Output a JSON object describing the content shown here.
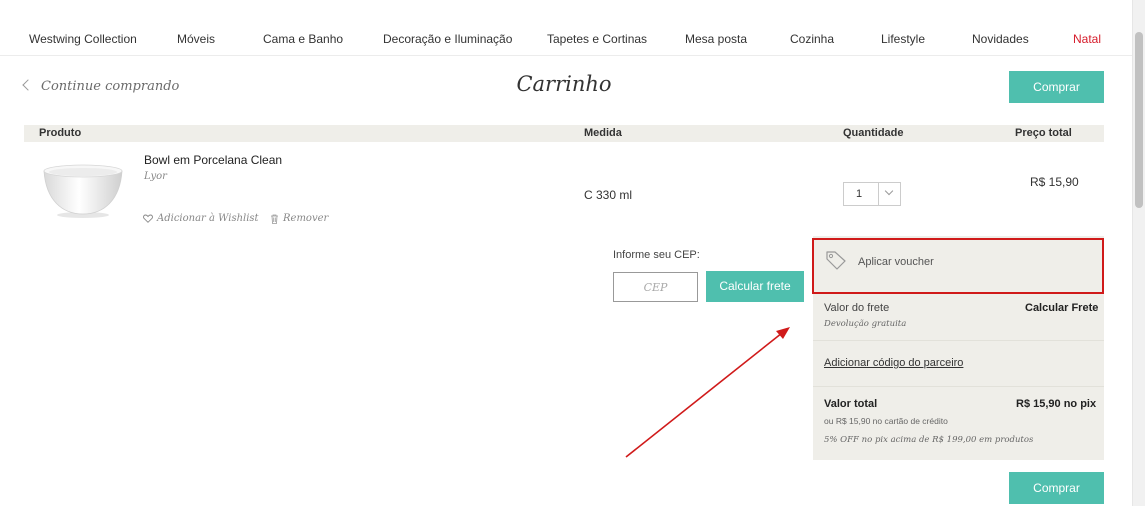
{
  "nav": {
    "items": [
      {
        "label": "Westwing Collection"
      },
      {
        "label": "Móveis"
      },
      {
        "label": "Cama e Banho"
      },
      {
        "label": "Decoração e Iluminação"
      },
      {
        "label": "Tapetes e Cortinas"
      },
      {
        "label": "Mesa posta"
      },
      {
        "label": "Cozinha"
      },
      {
        "label": "Lifestyle"
      },
      {
        "label": "Novidades"
      },
      {
        "label": "Natal",
        "highlight": true
      }
    ]
  },
  "header": {
    "continue_label": "Continue comprando",
    "title": "Carrinho",
    "buy_label": "Comprar"
  },
  "table": {
    "columns": [
      "Produto",
      "Medida",
      "Quantidade",
      "Preço total"
    ]
  },
  "cart_item": {
    "name": "Bowl em Porcelana Clean",
    "brand": "Lyor",
    "size": "C 330 ml",
    "quantity": "1",
    "price": "R$ 15,90",
    "wishlist_label": "Adicionar à Wishlist",
    "remove_label": "Remover"
  },
  "shipping": {
    "cep_label": "Informe seu CEP:",
    "cep_placeholder": "CEP",
    "calc_button": "Calcular frete"
  },
  "summary": {
    "voucher_label": "Aplicar voucher",
    "freight_label": "Valor do frete",
    "freight_value": "Calcular Frete",
    "returns_note": "Devolução gratuita",
    "partner_link": "Adicionar código do parceiro",
    "total_label": "Valor total",
    "total_value": "R$ 15,90 no pix",
    "credit_note": "ou R$ 15,90 no cartão de crédito",
    "pix_note": "5% OFF no pix acima de R$ 199,00 em produtos"
  },
  "footer": {
    "buy_label": "Comprar"
  },
  "colors": {
    "accent": "#4fbfae",
    "highlight_red": "#d61c2b",
    "annotation_red": "#d01a1a",
    "panel_bg": "#efeee9"
  },
  "icons": {
    "continue": "chevron-left-icon",
    "wishlist": "heart-icon",
    "remove": "trash-icon",
    "voucher": "tag-icon",
    "quantity": "chevron-down-icon"
  }
}
